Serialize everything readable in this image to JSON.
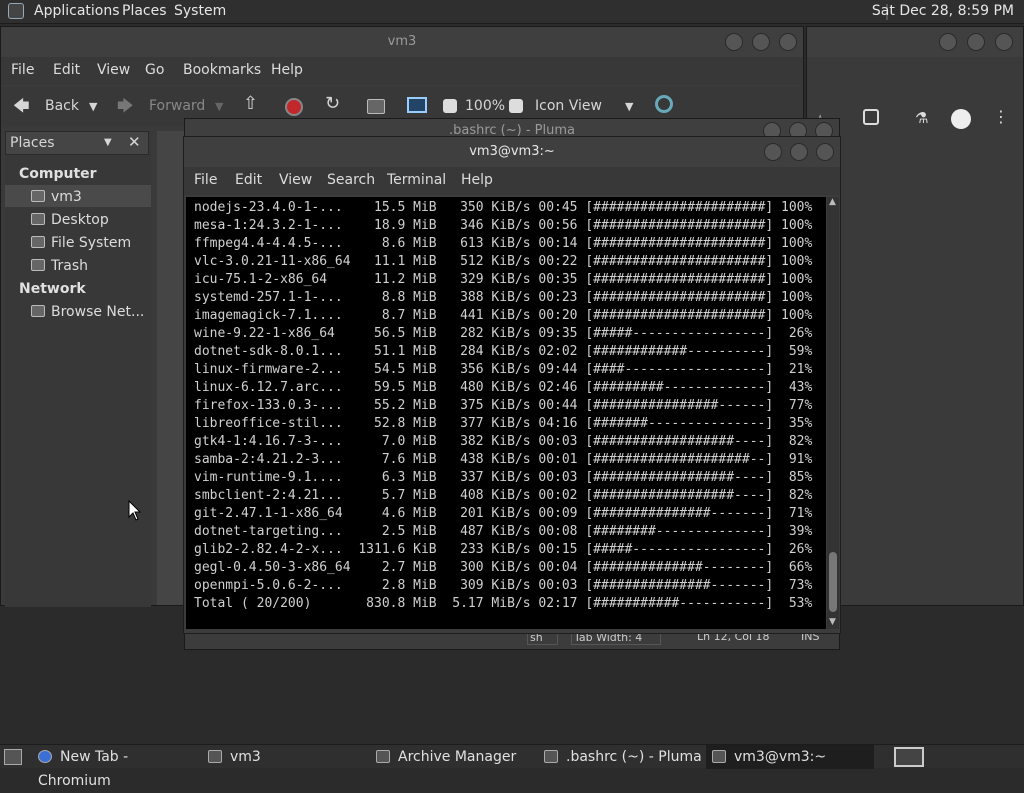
{
  "top_panel": {
    "applications": "Applications",
    "places": "Places",
    "system": "System",
    "clock": "Sat Dec 28,  8:59 PM"
  },
  "caja": {
    "title": "vm3",
    "menu": [
      "File",
      "Edit",
      "View",
      "Go",
      "Bookmarks",
      "Help"
    ],
    "toolbar": {
      "back": "Back",
      "forward": "Forward",
      "zoom": "100%",
      "view": "Icon View"
    },
    "places_label": "Places",
    "sections": {
      "computer": "Computer",
      "network": "Network"
    },
    "items": [
      "vm3",
      "Desktop",
      "File System",
      "Trash"
    ],
    "network_items": [
      "Browse Net..."
    ]
  },
  "pluma": {
    "title": ".bashrc (~) - Pluma",
    "status": {
      "lang": "sh",
      "tab": "Tab Width:  4",
      "pos": "Ln 12, Col 18",
      "ins": "INS"
    }
  },
  "terminal": {
    "title": "vm3@vm3:~",
    "menu": [
      "File",
      "Edit",
      "View",
      "Search",
      "Terminal",
      "Help"
    ],
    "lines": [
      "nodejs-23.4.0-1-...    15.5 MiB   350 KiB/s 00:45 [######################] 100%",
      "mesa-1:24.3.2-1-...    18.9 MiB   346 KiB/s 00:56 [######################] 100%",
      "ffmpeg4.4-4.4.5-...     8.6 MiB   613 KiB/s 00:14 [######################] 100%",
      "vlc-3.0.21-11-x86_64   11.1 MiB   512 KiB/s 00:22 [######################] 100%",
      "icu-75.1-2-x86_64      11.2 MiB   329 KiB/s 00:35 [######################] 100%",
      "systemd-257.1-1-...     8.8 MiB   388 KiB/s 00:23 [######################] 100%",
      "imagemagick-7.1....     8.7 MiB   441 KiB/s 00:20 [######################] 100%",
      "wine-9.22-1-x86_64     56.5 MiB   282 KiB/s 09:35 [#####-----------------]  26%",
      "dotnet-sdk-8.0.1...    51.1 MiB   284 KiB/s 02:02 [############----------]  59%",
      "linux-firmware-2...    54.5 MiB   356 KiB/s 09:44 [####------------------]  21%",
      "linux-6.12.7.arc...    59.5 MiB   480 KiB/s 02:46 [#########-------------]  43%",
      "firefox-133.0.3-...    55.2 MiB   375 KiB/s 00:44 [################------]  77%",
      "libreoffice-stil...    52.8 MiB   377 KiB/s 04:16 [#######---------------]  35%",
      "gtk4-1:4.16.7-3-...     7.0 MiB   382 KiB/s 00:03 [##################----]  82%",
      "samba-2:4.21.2-3...     7.6 MiB   438 KiB/s 00:01 [####################--]  91%",
      "vim-runtime-9.1....     6.3 MiB   337 KiB/s 00:03 [##################----]  85%",
      "smbclient-2:4.21...     5.7 MiB   408 KiB/s 00:02 [##################----]  82%",
      "git-2.47.1-1-x86_64     4.6 MiB   201 KiB/s 00:09 [###############-------]  71%",
      "dotnet-targeting...     2.5 MiB   487 KiB/s 00:08 [########--------------]  39%",
      "glib2-2.82.4-2-x...  1311.6 KiB   233 KiB/s 00:15 [#####-----------------]  26%",
      "gegl-0.4.50-3-x86_64    2.7 MiB   300 KiB/s 00:04 [##############--------]  66%",
      "openmpi-5.0.6-2-...     2.8 MiB   309 KiB/s 00:03 [###############-------]  73%",
      "Total ( 20/200)       830.8 MiB  5.17 MiB/s 02:17 [###########-----------]  53%"
    ]
  },
  "taskbar": {
    "items": [
      "New Tab - Chromium",
      "vm3",
      "Archive Manager",
      ".bashrc (~) - Pluma",
      "vm3@vm3:~"
    ]
  }
}
